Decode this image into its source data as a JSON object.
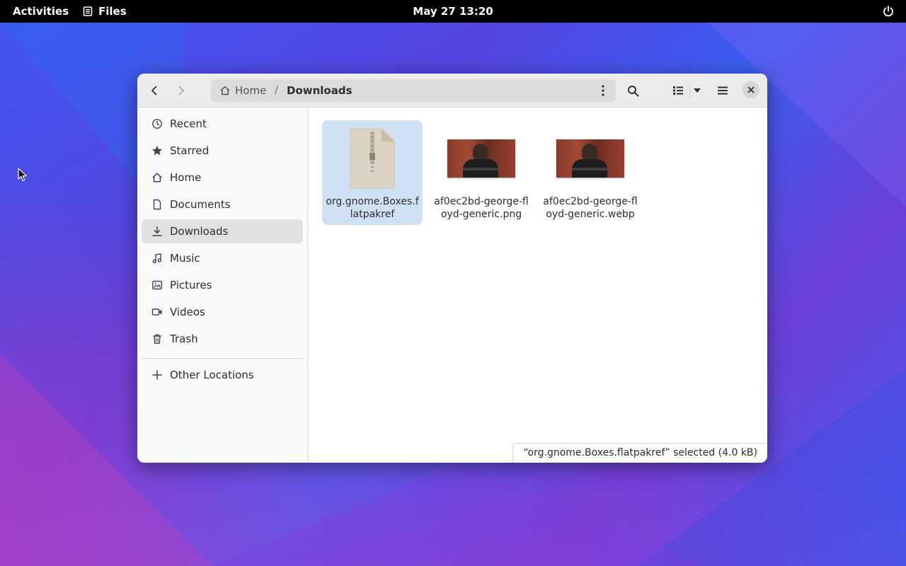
{
  "topbar": {
    "activities": "Activities",
    "app_name": "Files",
    "clock": "May 27  13:20"
  },
  "window": {
    "path": {
      "home": "Home",
      "separator": "/",
      "current": "Downloads"
    },
    "sidebar": {
      "items": [
        {
          "label": "Recent",
          "icon": "clock-icon"
        },
        {
          "label": "Starred",
          "icon": "star-icon"
        },
        {
          "label": "Home",
          "icon": "home-icon"
        },
        {
          "label": "Documents",
          "icon": "document-icon"
        },
        {
          "label": "Downloads",
          "icon": "download-icon",
          "active": true
        },
        {
          "label": "Music",
          "icon": "music-icon"
        },
        {
          "label": "Pictures",
          "icon": "picture-icon"
        },
        {
          "label": "Videos",
          "icon": "video-icon"
        },
        {
          "label": "Trash",
          "icon": "trash-icon"
        }
      ],
      "other_locations": "Other Locations"
    },
    "files": [
      {
        "name": "org.gnome.Boxes.flatpakref",
        "type": "archive",
        "selected": true
      },
      {
        "name": "af0ec2bd-george-floyd-generic.png",
        "type": "image"
      },
      {
        "name": "af0ec2bd-george-floyd-generic.webp",
        "type": "image"
      }
    ],
    "status": "“org.gnome.Boxes.flatpakref” selected  (4.0 kB)"
  }
}
